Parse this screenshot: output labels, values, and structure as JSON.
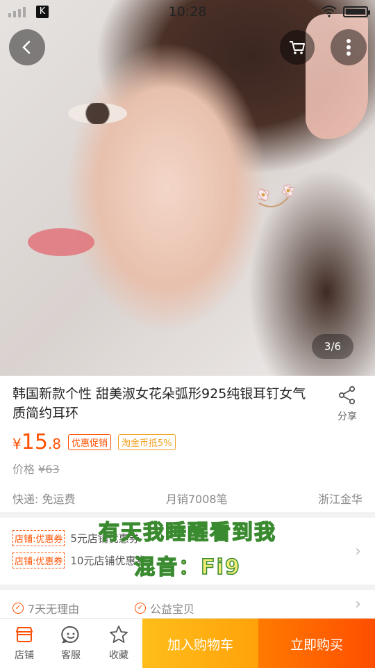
{
  "status": {
    "time": "10:28",
    "badge": "K"
  },
  "hero": {
    "pager": "3/6"
  },
  "product": {
    "title": "韩国新款个性 甜美淑女花朵弧形925纯银耳钉女气质简约耳环",
    "share_label": "分享",
    "price_currency": "¥",
    "price_int": "15",
    "price_dec": ".8",
    "tag_promo": "优惠促销",
    "tag_coin": "淘金币抵5%",
    "orig_label": "价格",
    "orig_price": "¥63",
    "shipping": "快递: 免运费",
    "sales": "月销7008笔",
    "location": "浙江金华"
  },
  "coupons": [
    {
      "tag": "店铺:优惠券",
      "text": "5元店铺优惠券"
    },
    {
      "tag": "店铺:优惠券",
      "text": "10元店铺优惠券"
    }
  ],
  "services": [
    {
      "label": "7天无理由"
    },
    {
      "label": "公益宝贝"
    }
  ],
  "captions": {
    "line1": "有天我睡醒看到我",
    "line2": "混音：Fi9"
  },
  "bottom": {
    "shop": "店铺",
    "service": "客服",
    "favorite": "收藏",
    "add_cart": "加入购物车",
    "buy_now": "立即购买"
  },
  "colors": {
    "accent": "#ff5000",
    "cart_btn": "#ffa20a",
    "buy_btn": "#ff4e00"
  }
}
